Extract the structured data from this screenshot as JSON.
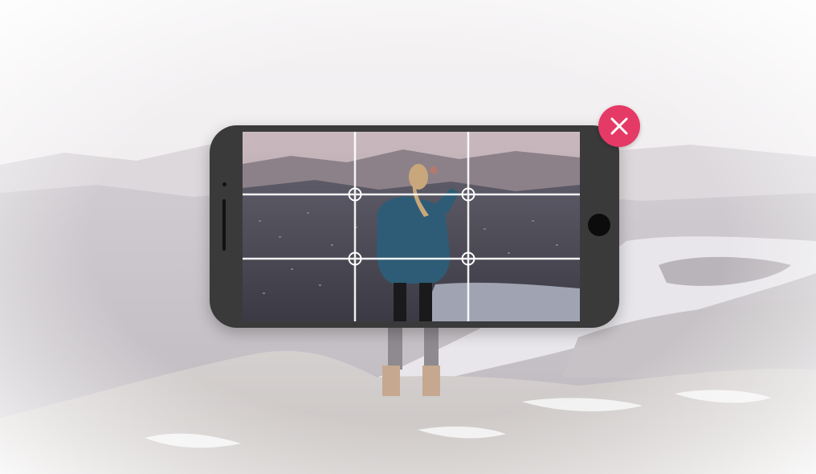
{
  "viewfinder": {
    "grid": "rule-of-thirds",
    "grid_color": "#ffffff",
    "intersection_marker": "crosshair-circle-icon"
  },
  "close_control": {
    "icon": "close-icon",
    "color": "#e53a66"
  },
  "device": {
    "orientation": "landscape",
    "body_color": "#3a3a3a"
  }
}
